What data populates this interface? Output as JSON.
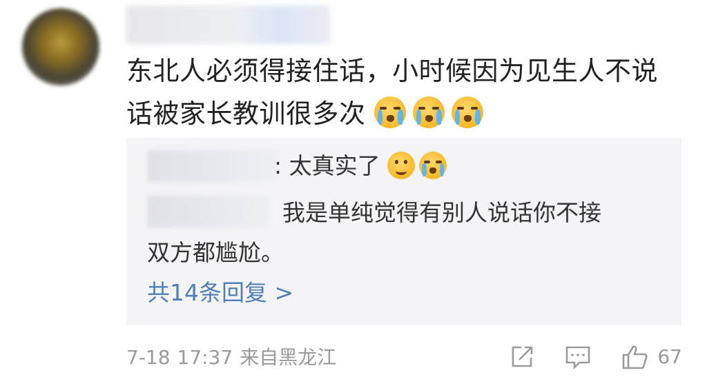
{
  "comment": {
    "text_line1": "东北人必须得接住话，小时候因为见生人不说",
    "text_line2": "话被家长教训很多次",
    "emojis": [
      "crying-face",
      "crying-face",
      "crying-face"
    ]
  },
  "replies": {
    "items": [
      {
        "text": ": 太真实了"
      },
      {
        "text": "我是单纯觉得有别人说话你不接",
        "continuation": "双方都尴尬。"
      }
    ],
    "more_label": "共14条回复 >"
  },
  "meta": {
    "date": "7-18",
    "time": "17:37",
    "location": "来自黑龙江",
    "like_count": "67"
  },
  "colors": {
    "link": "#4f7fb6",
    "meta_gray": "#9a9a9a",
    "reply_bg": "#f4f4f6"
  }
}
